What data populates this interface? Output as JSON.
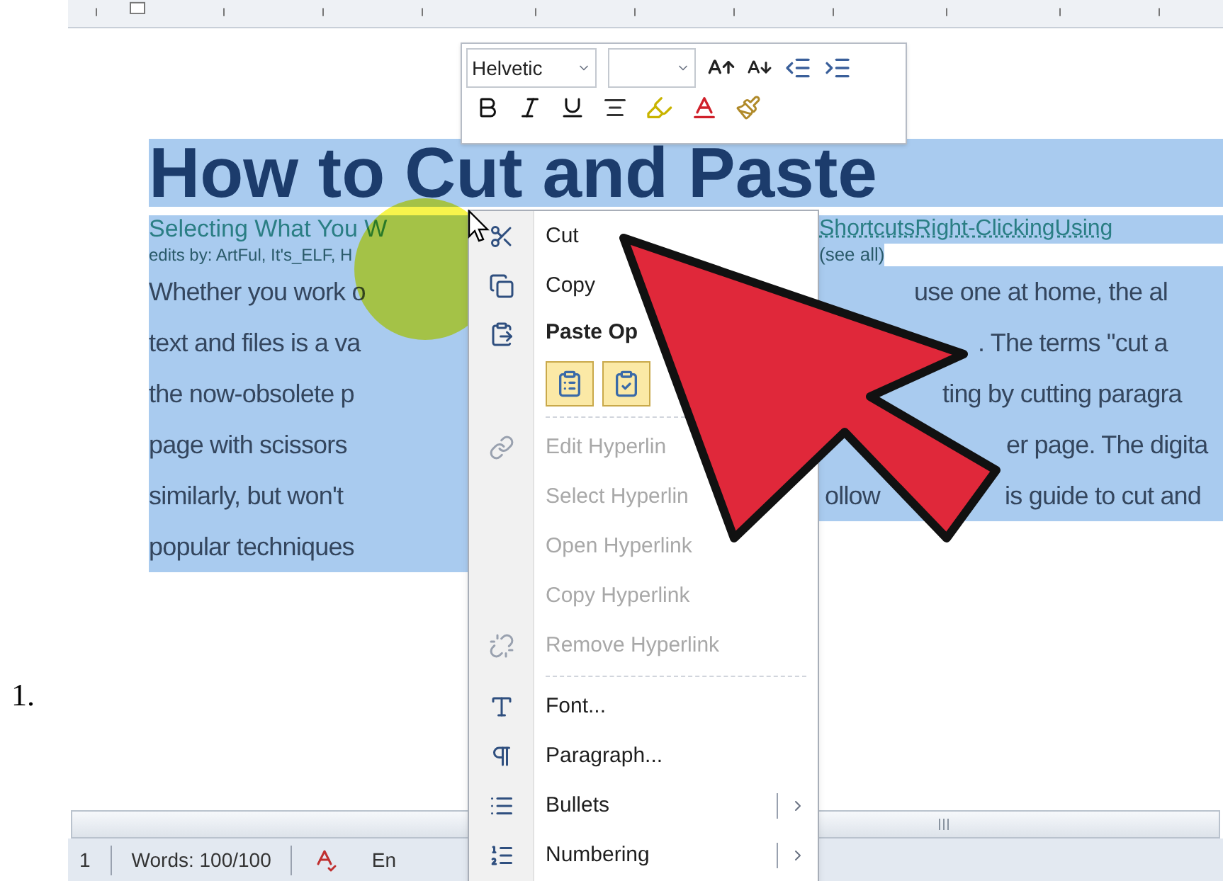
{
  "list_number": "1.",
  "mini_toolbar": {
    "font": "Helvetic"
  },
  "document": {
    "title": "How to Cut and Paste",
    "subtitle": {
      "left": "Selecting What You W",
      "right": "ShortcutsRight-ClickingUsing"
    },
    "edits": {
      "left": "edits by: ArtFul, It's_ELF, H",
      "right": "(see all)"
    },
    "lines": [
      {
        "left": "Whether you work o",
        "right": [
          "use one at home, the al"
        ]
      },
      {
        "left": "text and files is a va",
        "right": [
          ". The terms \"cut a"
        ]
      },
      {
        "left": "the now-obsolete p",
        "right": [
          "ting by cutting paragra"
        ]
      },
      {
        "left": "page with scissors",
        "right": [
          "er page. The digita"
        ]
      },
      {
        "left": "similarly, but won't",
        "right": [
          "ollow",
          "is guide to cut and"
        ]
      },
      {
        "left": "popular techniques"
      }
    ]
  },
  "context_menu": {
    "items": [
      {
        "kind": "item",
        "label": "Cut",
        "disabled": false,
        "submenu": false
      },
      {
        "kind": "item",
        "label": "Copy",
        "disabled": false,
        "submenu": false
      },
      {
        "kind": "header",
        "label": "Paste Op"
      },
      {
        "kind": "paste_icons"
      },
      {
        "kind": "separator"
      },
      {
        "kind": "item",
        "label": "Edit Hyperlin",
        "disabled": true,
        "submenu": false
      },
      {
        "kind": "item",
        "label": "Select Hyperlin",
        "disabled": true,
        "submenu": false
      },
      {
        "kind": "item",
        "label": "Open Hyperlink",
        "disabled": true,
        "submenu": false
      },
      {
        "kind": "item",
        "label": "Copy Hyperlink",
        "disabled": true,
        "submenu": false
      },
      {
        "kind": "item",
        "label": "Remove Hyperlink",
        "disabled": true,
        "submenu": false
      },
      {
        "kind": "separator"
      },
      {
        "kind": "item",
        "label": "Font...",
        "disabled": false,
        "submenu": false
      },
      {
        "kind": "item",
        "label": "Paragraph...",
        "disabled": false,
        "submenu": false
      },
      {
        "kind": "item",
        "label": "Bullets",
        "disabled": false,
        "submenu": true
      },
      {
        "kind": "item",
        "label": "Numbering",
        "disabled": false,
        "submenu": true
      }
    ]
  },
  "status_bar": {
    "page": "1",
    "words": "Words: 100/100",
    "language": "En"
  }
}
